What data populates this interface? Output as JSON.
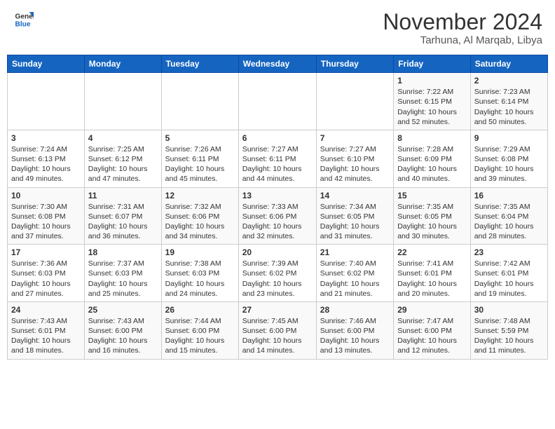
{
  "header": {
    "logo_line1": "General",
    "logo_line2": "Blue",
    "month": "November 2024",
    "location": "Tarhuna, Al Marqab, Libya"
  },
  "weekdays": [
    "Sunday",
    "Monday",
    "Tuesday",
    "Wednesday",
    "Thursday",
    "Friday",
    "Saturday"
  ],
  "weeks": [
    [
      {
        "date": "",
        "info": ""
      },
      {
        "date": "",
        "info": ""
      },
      {
        "date": "",
        "info": ""
      },
      {
        "date": "",
        "info": ""
      },
      {
        "date": "",
        "info": ""
      },
      {
        "date": "1",
        "info": "Sunrise: 7:22 AM\nSunset: 6:15 PM\nDaylight: 10 hours\nand 52 minutes."
      },
      {
        "date": "2",
        "info": "Sunrise: 7:23 AM\nSunset: 6:14 PM\nDaylight: 10 hours\nand 50 minutes."
      }
    ],
    [
      {
        "date": "3",
        "info": "Sunrise: 7:24 AM\nSunset: 6:13 PM\nDaylight: 10 hours\nand 49 minutes."
      },
      {
        "date": "4",
        "info": "Sunrise: 7:25 AM\nSunset: 6:12 PM\nDaylight: 10 hours\nand 47 minutes."
      },
      {
        "date": "5",
        "info": "Sunrise: 7:26 AM\nSunset: 6:11 PM\nDaylight: 10 hours\nand 45 minutes."
      },
      {
        "date": "6",
        "info": "Sunrise: 7:27 AM\nSunset: 6:11 PM\nDaylight: 10 hours\nand 44 minutes."
      },
      {
        "date": "7",
        "info": "Sunrise: 7:27 AM\nSunset: 6:10 PM\nDaylight: 10 hours\nand 42 minutes."
      },
      {
        "date": "8",
        "info": "Sunrise: 7:28 AM\nSunset: 6:09 PM\nDaylight: 10 hours\nand 40 minutes."
      },
      {
        "date": "9",
        "info": "Sunrise: 7:29 AM\nSunset: 6:08 PM\nDaylight: 10 hours\nand 39 minutes."
      }
    ],
    [
      {
        "date": "10",
        "info": "Sunrise: 7:30 AM\nSunset: 6:08 PM\nDaylight: 10 hours\nand 37 minutes."
      },
      {
        "date": "11",
        "info": "Sunrise: 7:31 AM\nSunset: 6:07 PM\nDaylight: 10 hours\nand 36 minutes."
      },
      {
        "date": "12",
        "info": "Sunrise: 7:32 AM\nSunset: 6:06 PM\nDaylight: 10 hours\nand 34 minutes."
      },
      {
        "date": "13",
        "info": "Sunrise: 7:33 AM\nSunset: 6:06 PM\nDaylight: 10 hours\nand 32 minutes."
      },
      {
        "date": "14",
        "info": "Sunrise: 7:34 AM\nSunset: 6:05 PM\nDaylight: 10 hours\nand 31 minutes."
      },
      {
        "date": "15",
        "info": "Sunrise: 7:35 AM\nSunset: 6:05 PM\nDaylight: 10 hours\nand 30 minutes."
      },
      {
        "date": "16",
        "info": "Sunrise: 7:35 AM\nSunset: 6:04 PM\nDaylight: 10 hours\nand 28 minutes."
      }
    ],
    [
      {
        "date": "17",
        "info": "Sunrise: 7:36 AM\nSunset: 6:03 PM\nDaylight: 10 hours\nand 27 minutes."
      },
      {
        "date": "18",
        "info": "Sunrise: 7:37 AM\nSunset: 6:03 PM\nDaylight: 10 hours\nand 25 minutes."
      },
      {
        "date": "19",
        "info": "Sunrise: 7:38 AM\nSunset: 6:03 PM\nDaylight: 10 hours\nand 24 minutes."
      },
      {
        "date": "20",
        "info": "Sunrise: 7:39 AM\nSunset: 6:02 PM\nDaylight: 10 hours\nand 23 minutes."
      },
      {
        "date": "21",
        "info": "Sunrise: 7:40 AM\nSunset: 6:02 PM\nDaylight: 10 hours\nand 21 minutes."
      },
      {
        "date": "22",
        "info": "Sunrise: 7:41 AM\nSunset: 6:01 PM\nDaylight: 10 hours\nand 20 minutes."
      },
      {
        "date": "23",
        "info": "Sunrise: 7:42 AM\nSunset: 6:01 PM\nDaylight: 10 hours\nand 19 minutes."
      }
    ],
    [
      {
        "date": "24",
        "info": "Sunrise: 7:43 AM\nSunset: 6:01 PM\nDaylight: 10 hours\nand 18 minutes."
      },
      {
        "date": "25",
        "info": "Sunrise: 7:43 AM\nSunset: 6:00 PM\nDaylight: 10 hours\nand 16 minutes."
      },
      {
        "date": "26",
        "info": "Sunrise: 7:44 AM\nSunset: 6:00 PM\nDaylight: 10 hours\nand 15 minutes."
      },
      {
        "date": "27",
        "info": "Sunrise: 7:45 AM\nSunset: 6:00 PM\nDaylight: 10 hours\nand 14 minutes."
      },
      {
        "date": "28",
        "info": "Sunrise: 7:46 AM\nSunset: 6:00 PM\nDaylight: 10 hours\nand 13 minutes."
      },
      {
        "date": "29",
        "info": "Sunrise: 7:47 AM\nSunset: 6:00 PM\nDaylight: 10 hours\nand 12 minutes."
      },
      {
        "date": "30",
        "info": "Sunrise: 7:48 AM\nSunset: 5:59 PM\nDaylight: 10 hours\nand 11 minutes."
      }
    ]
  ]
}
